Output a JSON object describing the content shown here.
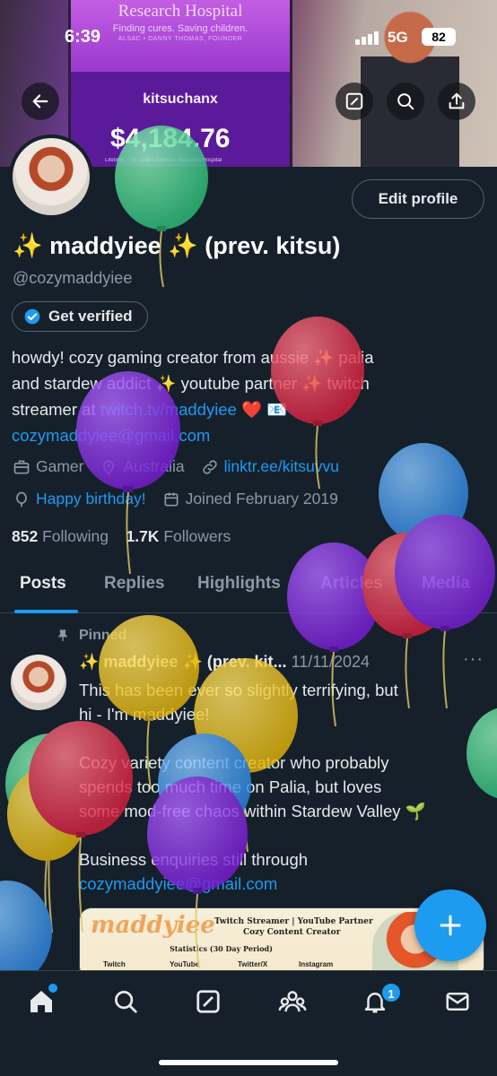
{
  "status_bar": {
    "time": "6:39",
    "network": "5G",
    "battery": "82"
  },
  "banner": {
    "hospital": "Research Hospital",
    "tagline": "Finding cures. Saving children.",
    "founder": "ALSAC • DANNY THOMAS, FOUNDER",
    "stream_name": "kitsuchanx",
    "amount": "$4,184.76",
    "footer": "Lifetime ... St. Jude Children's Research Hospital"
  },
  "header_buttons": [
    "back-icon",
    "edit-icon",
    "search-icon",
    "share-icon"
  ],
  "profile": {
    "display_name": "✨ maddyiee ✨ (prev. kitsu)",
    "handle": "@cozymaddyiee",
    "verify_label": "Get verified",
    "edit_label": "Edit profile",
    "bio": {
      "line1": "howdy! cozy gaming creator from aussie ✨ palia",
      "line2": "and stardew addict ✨ youtube partner ✨ twitch",
      "line3_prefix": "streamer at ",
      "line3_link": "twitch.tv/maddyiee",
      "line3_suffix": " ❤️ 📧",
      "email": "cozymaddyiee@gmail.com"
    },
    "category": "Gamer",
    "location": "Australia",
    "website": "linktr.ee/kitsuvvu",
    "birthday": "Happy birthday!",
    "joined": "Joined February 2019",
    "following_count": "852",
    "following_label": "Following",
    "followers_count": "1.7K",
    "followers_label": "Followers"
  },
  "tabs": [
    {
      "label": "Posts"
    },
    {
      "label": "Replies"
    },
    {
      "label": "Highlights"
    },
    {
      "label": "Articles"
    },
    {
      "label": "Media"
    }
  ],
  "post": {
    "pinned_label": "Pinned",
    "author": "✨ maddyiee ✨ (prev. kit...",
    "date": "11/11/2024",
    "more": "···",
    "p1_line1": "This has been ever so slightly terrifying, but",
    "p1_line2": "hi - I'm maddyiee!",
    "p2_line1": "Cozy variety content creator who probably",
    "p2_line2": "spends too much time on Palia, but loves",
    "p2_line3": "some mod-free chaos within Stardew Valley 🌱",
    "p3_line1": "Business enquiries still through",
    "p3_link": "cozymaddyiee@gmail.com",
    "media": {
      "logo": "maddyiee",
      "line1": "Twitch Streamer | YouTube Partner",
      "line2": "Cozy Content Creator",
      "line3": "Statistics (30 Day Period)",
      "platforms": [
        "Twitch",
        "YouTube",
        "Twitter/X",
        "Instagram"
      ]
    }
  },
  "nav": {
    "items": [
      "home-icon",
      "search-icon",
      "grok-icon",
      "communities-icon",
      "notifications-icon",
      "messages-icon"
    ],
    "notification_count": "1"
  },
  "colors": {
    "accent": "#1d9bf0",
    "background": "#15202b",
    "muted": "#8b98a5"
  }
}
